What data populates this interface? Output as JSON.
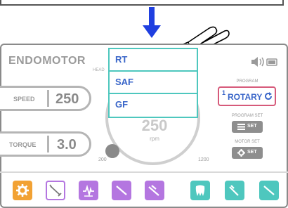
{
  "header": {
    "title": "ENDOMOTOR",
    "head_label": "HEAD"
  },
  "menu": {
    "items": [
      {
        "label": "RT"
      },
      {
        "label": "SAF"
      },
      {
        "label": "GF"
      }
    ]
  },
  "speed": {
    "label": "SPEED",
    "value": "250"
  },
  "torque": {
    "label": "TORQUE",
    "value": "3.0"
  },
  "dial": {
    "value": "250",
    "unit": "rpm",
    "min": "200",
    "max": "1200"
  },
  "program": {
    "label": "PROGRAM",
    "number": "1",
    "name": "ROTARY"
  },
  "program_set": {
    "label": "PROGRAM SET",
    "button": "SET"
  },
  "motor_set": {
    "label": "MOTOR SET",
    "button": "SET"
  },
  "colors": {
    "accent": "#4ec7be",
    "menu_text": "#3a66c9",
    "program_border": "#d65a7a",
    "settings": "#f2a234",
    "purple": "#b476e0",
    "teal": "#4ec7be",
    "arrow": "#1f3fe0"
  },
  "toolbar": {
    "icons": [
      "gear-icon",
      "handpiece-icon",
      "ecg-icon",
      "file-icon",
      "file-pair-icon",
      "tooth-icon",
      "tool-icon",
      "file-tool-icon"
    ]
  }
}
